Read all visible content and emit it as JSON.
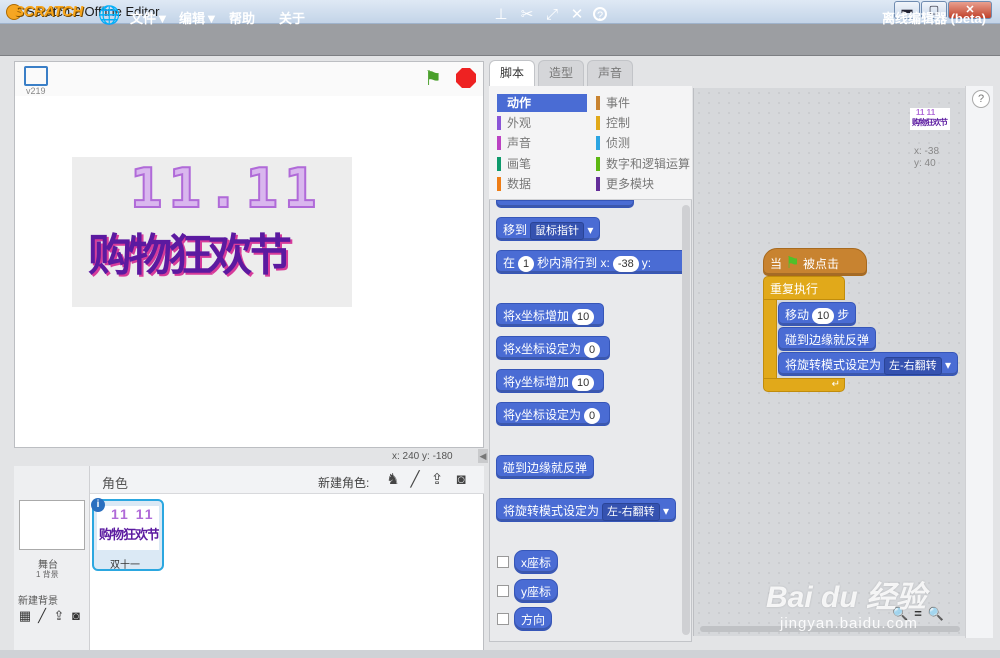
{
  "window": {
    "title": "Scratch 2 Offline Editor",
    "minimize": "▬",
    "maximize": "▢",
    "close": "✕"
  },
  "menubar": {
    "logo": "SCRATCH",
    "items": [
      "文件▼",
      "编辑▼",
      "帮助",
      "关于"
    ],
    "right_label": "离线编辑器 (beta)"
  },
  "stage": {
    "version": "v219",
    "image_text_top": "11.11",
    "image_text_bottom": "购物狂欢节",
    "coords": "x: 240  y: -180"
  },
  "sprites": {
    "header": "角色",
    "new_sprite_label": "新建角色:",
    "stage_label": "舞台",
    "stage_sub": "1 背景",
    "new_backdrop_label": "新建背景",
    "sprite_name": "双十一",
    "sprite_image_text": "11 11\n购物狂欢节"
  },
  "tabs": [
    "脚本",
    "造型",
    "声音"
  ],
  "categories": [
    {
      "label": "动作",
      "color": "#4a6cd4",
      "active": true
    },
    {
      "label": "事件",
      "color": "#c88330"
    },
    {
      "label": "外观",
      "color": "#8a55d7"
    },
    {
      "label": "控制",
      "color": "#e1a91a"
    },
    {
      "label": "声音",
      "color": "#bb42c3"
    },
    {
      "label": "侦测",
      "color": "#2ca5e2"
    },
    {
      "label": "画笔",
      "color": "#0e9a6c"
    },
    {
      "label": "数字和逻辑运算",
      "color": "#5cb712"
    },
    {
      "label": "数据",
      "color": "#ee7d16"
    },
    {
      "label": "更多模块",
      "color": "#632d99"
    }
  ],
  "palette_blocks": {
    "goto": "移到",
    "goto_target": "鼠标指针",
    "glide_pre": "在",
    "glide_secs": "1",
    "glide_mid": "秒内滑行到 x:",
    "glide_x": "-38",
    "glide_y": "y:",
    "changex": "将x坐标增加",
    "changex_val": "10",
    "setx": "将x坐标设定为",
    "setx_val": "0",
    "changey": "将y坐标增加",
    "changey_val": "10",
    "sety": "将y坐标设定为",
    "sety_val": "0",
    "bounce": "碰到边缘就反弹",
    "rotstyle": "将旋转模式设定为",
    "rotstyle_val": "左-右翻转",
    "xpos": "x座标",
    "ypos": "y座标",
    "dir": "方向"
  },
  "script": {
    "hat_pre": "当",
    "hat_post": "被点击",
    "forever": "重复执行",
    "move": "移动",
    "move_val": "10",
    "move_unit": "步",
    "bounce": "碰到边缘就反弹",
    "rotstyle": "将旋转模式设定为",
    "rotstyle_val": "左-右翻转",
    "sprite_x": "x: -38",
    "sprite_y": "y: 40"
  },
  "zoom": {
    "out": "🔍",
    "reset": "=",
    "in": "🔍"
  },
  "help": "?",
  "watermark": {
    "logo": "Bai du 经验",
    "url": "jingyan.baidu.com"
  }
}
